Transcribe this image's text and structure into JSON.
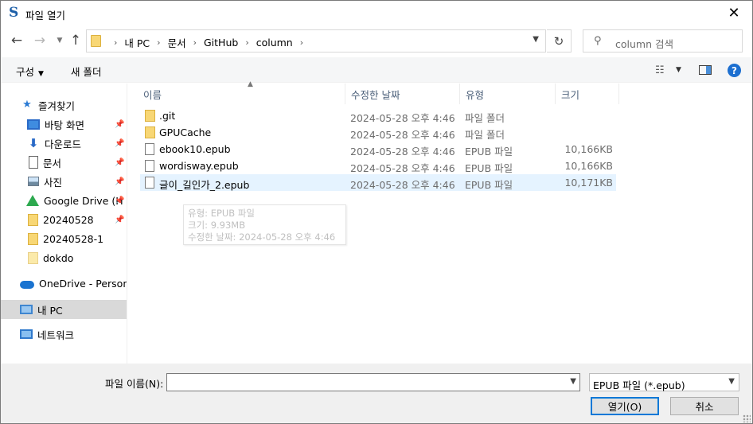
{
  "window": {
    "title": "파일 열기",
    "app_icon_glyph": "S",
    "close_glyph": "✕"
  },
  "address": {
    "crumbs": [
      "내 PC",
      "문서",
      "GitHub",
      "column"
    ],
    "search_placeholder": "column 검색"
  },
  "toolbar": {
    "organize_label": "구성",
    "new_folder_label": "새 폴더"
  },
  "nav": {
    "items": [
      {
        "label": "즐겨찾기",
        "icon": "star-icon",
        "pinned": false
      },
      {
        "label": "바탕 화면",
        "icon": "desktop-icon",
        "pinned": true
      },
      {
        "label": "다운로드",
        "icon": "download-icon",
        "pinned": true
      },
      {
        "label": "문서",
        "icon": "document-icon",
        "pinned": true
      },
      {
        "label": "사진",
        "icon": "pictures-icon",
        "pinned": true
      },
      {
        "label": "Google Drive (H",
        "icon": "google-drive-icon",
        "pinned": true
      },
      {
        "label": "20240528",
        "icon": "folder-icon",
        "pinned": true
      },
      {
        "label": "20240528-1",
        "icon": "folder-icon",
        "pinned": false
      },
      {
        "label": "dokdo",
        "icon": "folder-icon",
        "pinned": false
      },
      {
        "label": "OneDrive - Personal",
        "icon": "onedrive-icon",
        "pinned": false
      },
      {
        "label": "내 PC",
        "icon": "this-pc-icon",
        "pinned": false,
        "selected": true
      },
      {
        "label": "네트워크",
        "icon": "network-icon",
        "pinned": false
      }
    ]
  },
  "columns": {
    "name": "이름",
    "date": "수정한 날짜",
    "type": "유형",
    "size": "크기"
  },
  "files": [
    {
      "name": ".git",
      "date": "2024-05-28 오후 4:46",
      "type": "파일 폴더",
      "size": "",
      "kind": "folder"
    },
    {
      "name": "GPUCache",
      "date": "2024-05-28 오후 4:46",
      "type": "파일 폴더",
      "size": "",
      "kind": "folder"
    },
    {
      "name": "ebook10.epub",
      "date": "2024-05-28 오후 4:46",
      "type": "EPUB 파일",
      "size": "10,166KB",
      "kind": "file"
    },
    {
      "name": "wordisway.epub",
      "date": "2024-05-28 오후 4:46",
      "type": "EPUB 파일",
      "size": "10,166KB",
      "kind": "file"
    },
    {
      "name": "글이_길인가_2.epub",
      "date": "2024-05-28 오후 4:46",
      "type": "EPUB 파일",
      "size": "10,171KB",
      "kind": "file",
      "hovered": true
    }
  ],
  "tooltip": {
    "type_line": "유형: EPUB 파일",
    "size_line": "크기: 9.93MB",
    "date_line": "수정한 날짜: 2024-05-28 오후 4:46"
  },
  "bottom": {
    "filename_label": "파일 이름(N):",
    "filename_value": "",
    "filter_label": "EPUB 파일 (*.epub)",
    "open_label": "열기(O)",
    "cancel_label": "취소"
  },
  "colors": {
    "accent": "#0078d7",
    "hover_row": "#e5f3ff",
    "selected_nav": "#d9d9d9",
    "folder": "#f8d775",
    "help": "#1c6fd0"
  }
}
